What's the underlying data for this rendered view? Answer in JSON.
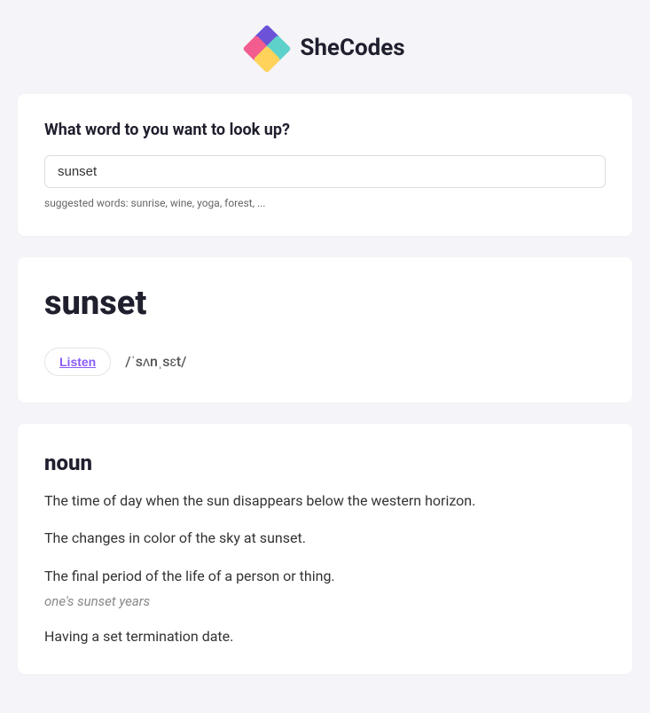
{
  "header": {
    "brand": "SheCodes"
  },
  "search": {
    "prompt": "What word to you want to look up?",
    "value": "sunset",
    "hint": "suggested words: sunrise, wine, yoga, forest, ..."
  },
  "result": {
    "word": "sunset",
    "listen_label": "Listen",
    "phonetic": "/ˈsʌnˌsɛt/"
  },
  "meaning": {
    "part_of_speech": "noun",
    "definitions": [
      {
        "text": "The time of day when the sun disappears below the western horizon."
      },
      {
        "text": "The changes in color of the sky at sunset."
      },
      {
        "text": "The final period of the life of a person or thing.",
        "example": "one's sunset years"
      },
      {
        "text": "Having a set termination date."
      }
    ]
  }
}
